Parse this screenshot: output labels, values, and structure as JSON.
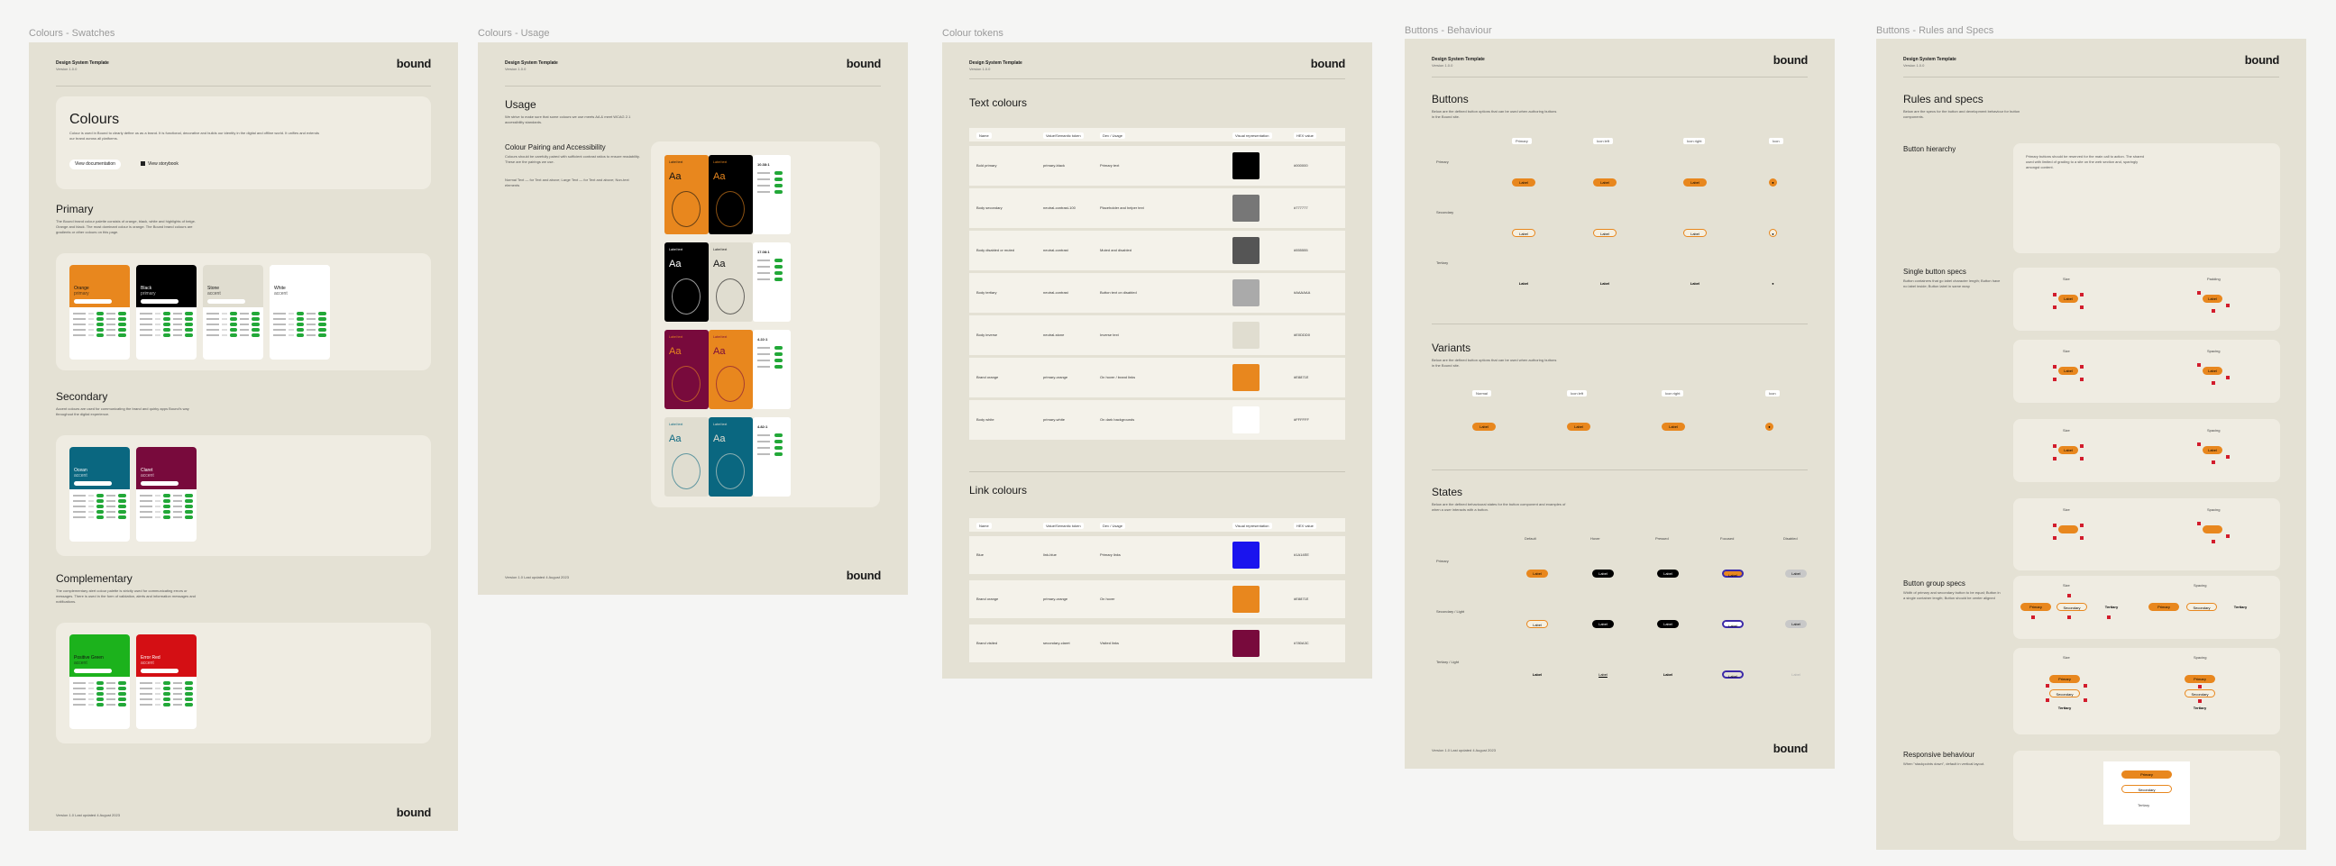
{
  "frames": {
    "swatches": "Colours - Swatches",
    "usage": "Colours - Usage",
    "tokens": "Colour tokens",
    "behaviour": "Buttons - Behaviour",
    "rules": "Buttons - Rules and Specs"
  },
  "common": {
    "doc_title": "Design System Template",
    "version": "Version 1.0.0",
    "logo": "bound",
    "footer": "Version 1.0 Last updated 4 August 2023"
  },
  "swatches": {
    "hero_title": "Colours",
    "hero_text": "Colour is used in Bound to clearly define us as a brand. It is functional, decorative and builds our identity in the digital and offline world. It unifies and extends our brand across all platforms.",
    "btn_documentation": "View documentation",
    "btn_storybook": "View storybook",
    "primary_title": "Primary",
    "primary_text": "The Bound brand colour palette consists of orange, black, white and highlights of beige. Orange and black. The most dominant colour is orange. The Bound brand colours are gradients or other colours on this page.",
    "secondary_title": "Secondary",
    "secondary_text": "Accent colours are used for communicating the brand and quirky apps Bound's way throughout the digital experience.",
    "complementary_title": "Complementary",
    "complementary_text": "The complementary alert colour palette is strictly used for communicating errors or messages. There is used in the form of validation, alerts and information messages and notifications.",
    "swatch_pill": "#000000",
    "primary_swatches": [
      {
        "name": "Orange",
        "sub": "primary",
        "color": "#e8871e",
        "text": "#111111"
      },
      {
        "name": "Black",
        "sub": "primary",
        "color": "#000000",
        "text": "#ffffff"
      },
      {
        "name": "Stone",
        "sub": "accent",
        "color": "#e0ddd0",
        "text": "#111111"
      },
      {
        "name": "White",
        "sub": "accent",
        "color": "#ffffff",
        "text": "#111111"
      }
    ],
    "secondary_swatches": [
      {
        "name": "Ocean",
        "sub": "accent",
        "color": "#0a6780",
        "text": "#ffffff"
      },
      {
        "name": "Claret",
        "sub": "accent",
        "color": "#780a3c",
        "text": "#ffffff"
      }
    ],
    "complementary_swatches": [
      {
        "name": "Positive Green",
        "sub": "accent",
        "color": "#1cb21c",
        "text": "#111111"
      },
      {
        "name": "Error Red",
        "sub": "accent",
        "color": "#d40f14",
        "text": "#ffffff"
      }
    ]
  },
  "usage": {
    "title": "Usage",
    "text": "We strive to make sure that some colours we use meets AA & meet WCAG 2.1 accessibility standards.",
    "sub_title": "Colour Pairing and Accessibility",
    "sub_text": "Colours should be carefully paired with sufficient contrast ratios to ensure readability. These are the pairings we use.",
    "list": "Normal Text — for Text and above; Large Text — for Text and above; Non-text elements",
    "aa": "Aa",
    "pair_label": "Label text",
    "cards": [
      {
        "left": "#e8871e",
        "right": "#000000",
        "lt": "#111111",
        "rt": "#e8871e",
        "ratio": "10.38:1"
      },
      {
        "left": "#000000",
        "right": "#e0ddd0",
        "lt": "#ffffff",
        "rt": "#111111",
        "ratio": "17.08:1"
      },
      {
        "left": "#780a3c",
        "right": "#e8871e",
        "lt": "#e8871e",
        "rt": "#780a3c",
        "ratio": "4.22:1"
      },
      {
        "left": "#e0ddd0",
        "right": "#0a6780",
        "lt": "#0a6780",
        "rt": "#e0ddd0",
        "ratio": "4.82:1"
      }
    ]
  },
  "tokens": {
    "text_title": "Text colours",
    "link_title": "Link colours",
    "headers": [
      "Name",
      "Value/Semantic token",
      "Dev / Usage",
      "Visual representation",
      "HEX value"
    ],
    "text_rows": [
      {
        "name": "Bold primary",
        "value": "primary-black",
        "usage": "Primary text",
        "color": "#000000",
        "hex": "#000000"
      },
      {
        "name": "Body secondary",
        "value": "neutral-contrast-100",
        "usage": "Placeholder and helper text",
        "color": "#777777",
        "hex": "#777777"
      },
      {
        "name": "Body disabled or muted",
        "value": "neutral-contrast",
        "usage": "Muted and disabled",
        "color": "#555555",
        "hex": "#555555"
      },
      {
        "name": "Body tertiary",
        "value": "neutral-contrast",
        "usage": "Button text on disabled",
        "color": "#aaaaaa",
        "hex": "#AAAAAA"
      },
      {
        "name": "Body inverse",
        "value": "neutral-stone",
        "usage": "Inverse text",
        "color": "#e0ddd0",
        "hex": "#E0DDD0"
      },
      {
        "name": "Brand orange",
        "value": "primary-orange",
        "usage": "On hover / brand links",
        "color": "#e8871e",
        "hex": "#E8871E"
      },
      {
        "name": "Body white",
        "value": "primary-white",
        "usage": "On dark backgrounds",
        "color": "#ffffff",
        "hex": "#FFFFFF"
      }
    ],
    "link_rows": [
      {
        "name": "Blue",
        "value": "link-blue",
        "usage": "Primary links",
        "color": "#1a14ee",
        "hex": "#1A14EE"
      },
      {
        "name": "Brand orange",
        "value": "primary-orange",
        "usage": "On hover",
        "color": "#e8871e",
        "hex": "#E8871E"
      },
      {
        "name": "Brand visited",
        "value": "secondary-claret",
        "usage": "Visited links",
        "color": "#780a3c",
        "hex": "#780A3C"
      }
    ]
  },
  "behaviour": {
    "buttons_title": "Buttons",
    "buttons_text": "Below are the defined button options that can be used when authoring buttons in the Bound site.",
    "variants_title": "Variants",
    "variants_text": "Below are the defined button options that can be used when authoring buttons in the Bound site.",
    "states_title": "States",
    "states_text": "Below are the defined behavioural states for the button component and examples of when a user interacts with a button.",
    "label": "Label",
    "col_heads": [
      "Primary",
      "Icon left",
      "Icon right",
      "Icon"
    ],
    "row_heads": [
      "Primary",
      "Secondary",
      "Tertiary"
    ],
    "variant_heads": [
      "Normal",
      "Icon left",
      "Icon right",
      "Icon"
    ],
    "state_heads": [
      "Default",
      "Hover",
      "Pressed",
      "Focused",
      "Disabled"
    ],
    "state_rows": [
      "Primary",
      "Secondary / Light",
      "Tertiary / Light"
    ]
  },
  "rules": {
    "title": "Rules and specs",
    "text": "Below are the specs for the button and development behaviour for button components.",
    "hierarchy_title": "Button hierarchy",
    "hierarchy_text": "Primary buttons should be reserved for the main call to action. The shared used with limited of grading to a site on the web section and, sparingly amongst content.",
    "single_title": "Single button specs",
    "single_list": "Button containers that go label character length; Button have no label inside; Button label in same wrap",
    "group_title": "Button group specs",
    "group_list": "Width of primary and secondary button to be equal; Button in a single container length; Button should be center aligned",
    "responsive_title": "Responsive behaviour",
    "responsive_text": "When \"stackpoints down\", default in vertical layout.",
    "size": "Size",
    "spacing": "Spacing",
    "padding": "Padding",
    "label": "Label",
    "primary": "Primary",
    "secondary": "Secondary",
    "tertiary": "Tertiary"
  }
}
